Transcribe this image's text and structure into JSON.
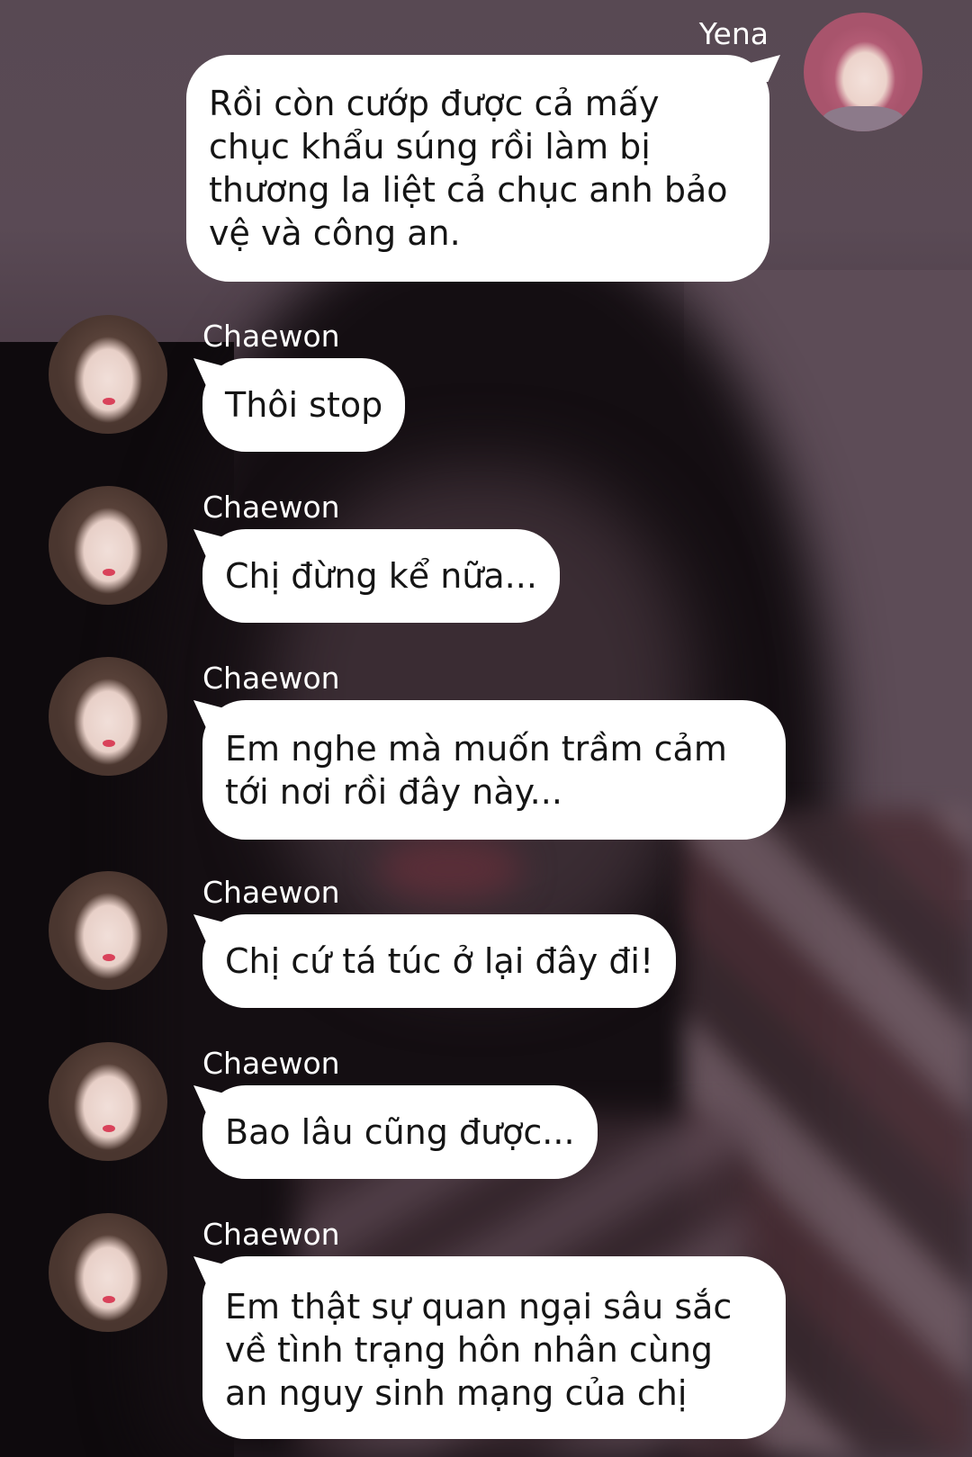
{
  "messages": [
    {
      "sender": "Yena",
      "side": "right",
      "text": "Rồi còn cướp được cả mấy chục khẩu súng rồi làm bị thương la liệt cả chục anh bảo vệ và công an."
    },
    {
      "sender": "Chaewon",
      "side": "left",
      "text": "Thôi stop"
    },
    {
      "sender": "Chaewon",
      "side": "left",
      "text": "Chị đừng kể nữa..."
    },
    {
      "sender": "Chaewon",
      "side": "left",
      "text": "Em nghe mà muốn trầm cảm tới nơi rồi đây này..."
    },
    {
      "sender": "Chaewon",
      "side": "left",
      "text": "Chị cứ tá túc ở lại đây đi!"
    },
    {
      "sender": "Chaewon",
      "side": "left",
      "text": "Bao lâu cũng được..."
    },
    {
      "sender": "Chaewon",
      "side": "left",
      "text": "Em thật sự quan ngại sâu sắc về tình trạng hôn nhân cùng an nguy sinh mạng của chị"
    }
  ],
  "colors": {
    "bubble": "#ffffff",
    "name_text": "#ffffff",
    "message_text": "#151515"
  }
}
